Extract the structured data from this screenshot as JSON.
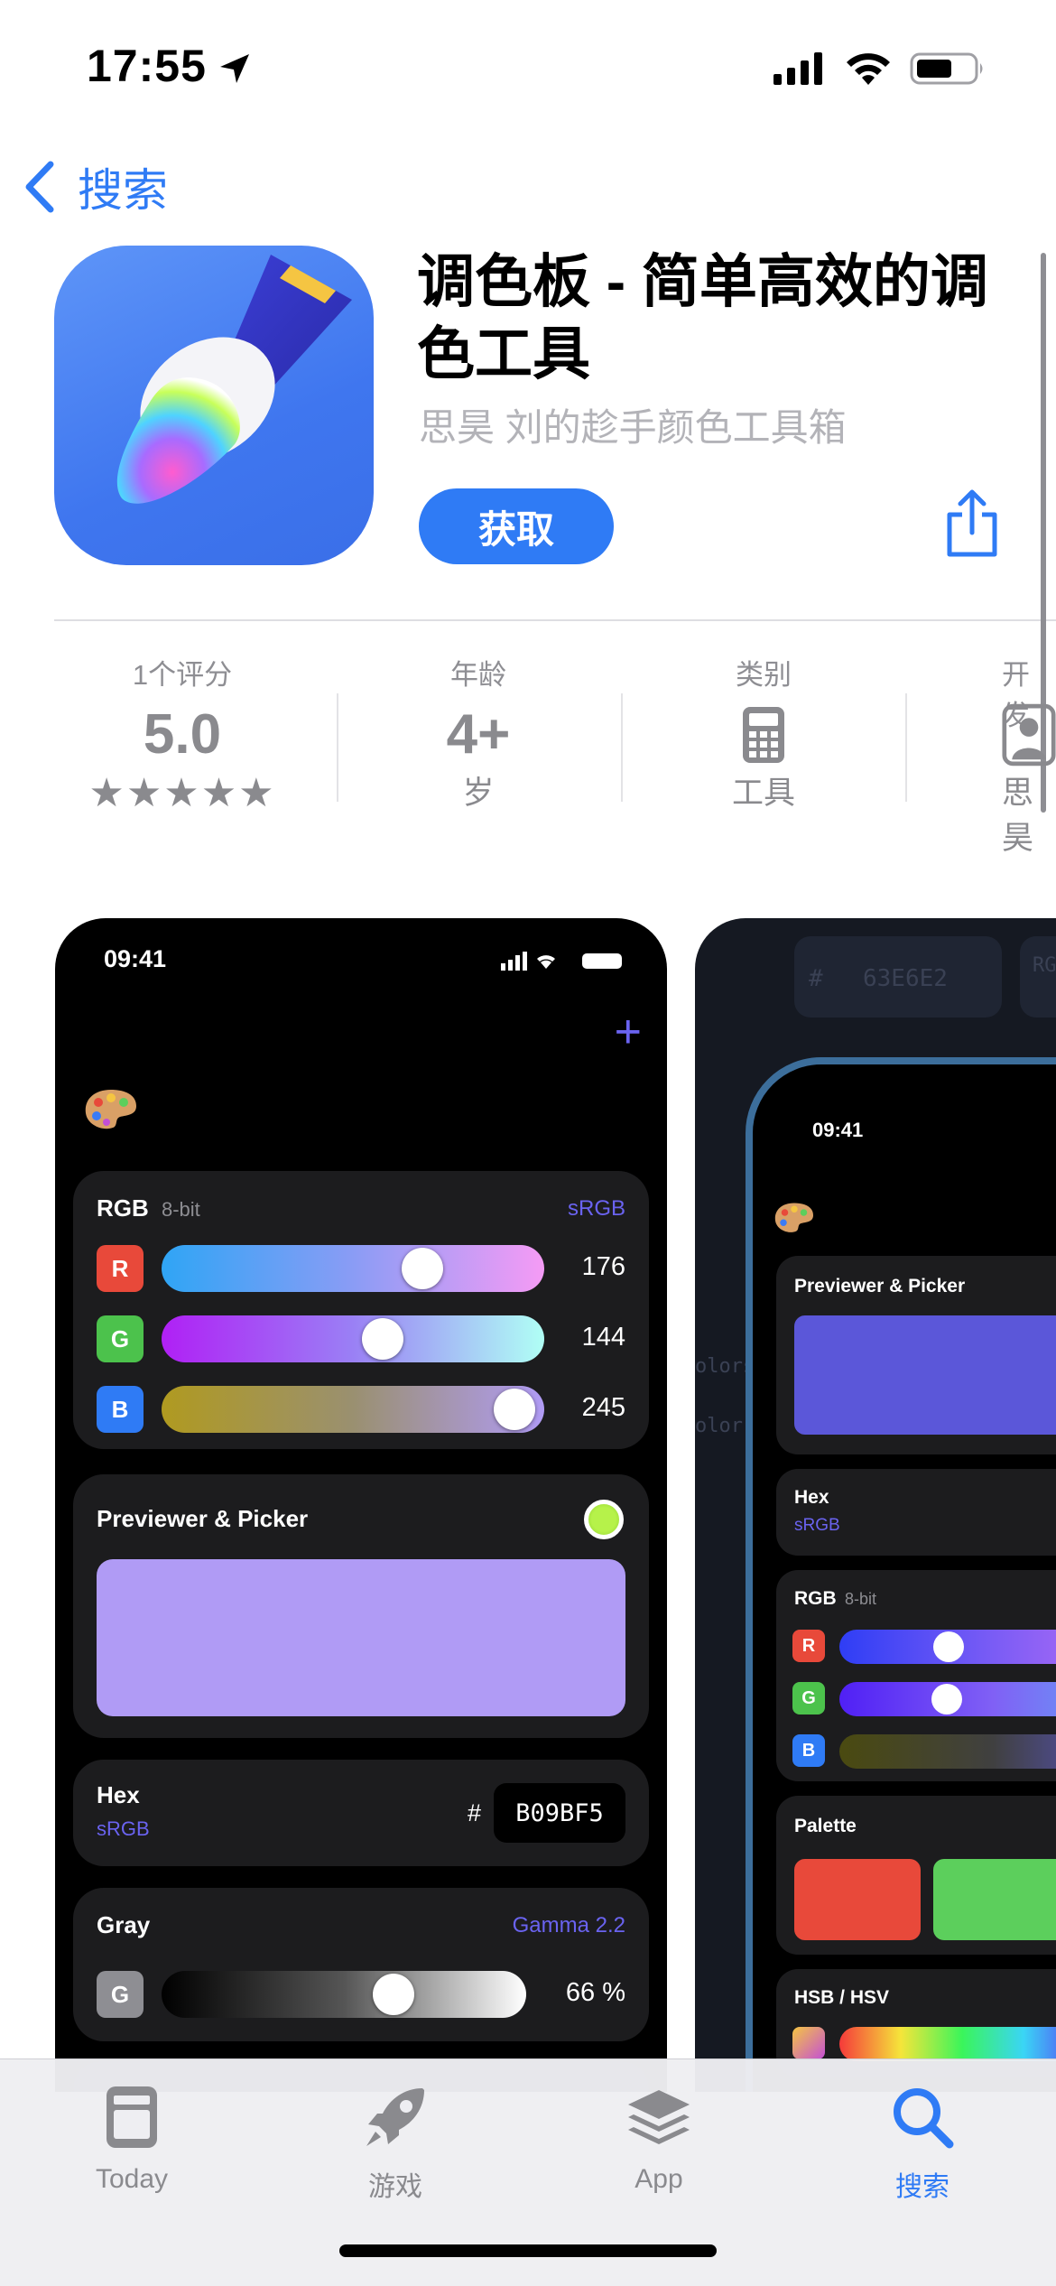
{
  "status_bar": {
    "time": "17:55"
  },
  "nav": {
    "back_label": "搜索"
  },
  "app": {
    "title": "调色板 - 简单高效的调色工具",
    "subtitle": "思昊 刘的趁手颜色工具箱",
    "get_label": "获取"
  },
  "info": [
    {
      "label": "1个评分",
      "value": "5.0",
      "sub": "★★★★★"
    },
    {
      "label": "年龄",
      "value": "4+",
      "sub": "岁"
    },
    {
      "label": "类别",
      "value": "",
      "sub": "工具",
      "icon": "calculator-icon"
    },
    {
      "label": "开发",
      "value": "",
      "sub": "思昊",
      "icon": "person-icon"
    }
  ],
  "screenshot1": {
    "time": "09:41",
    "rgb": {
      "title": "RGB",
      "bits": "8-bit",
      "space": "sRGB",
      "channels": [
        {
          "name": "R",
          "value": "176"
        },
        {
          "name": "G",
          "value": "144"
        },
        {
          "name": "B",
          "value": "245"
        }
      ]
    },
    "previewer": {
      "title": "Previewer & Picker",
      "color": "#b09bf5"
    },
    "hex": {
      "title": "Hex",
      "space": "sRGB",
      "hash": "#",
      "value": "B09BF5"
    },
    "gray": {
      "title": "Gray",
      "gamma": "Gamma 2.2",
      "channel": "G",
      "value": "66 %"
    }
  },
  "screenshot2": {
    "bg_hex": "63E6E2",
    "bg_label": "RG",
    "bg_frag1": "olors",
    "bg_frag2": "olor:",
    "time": "09:41",
    "previewer_title": "Previewer & Picker",
    "preview_color": "#5b57d9",
    "hex_title": "Hex",
    "hex_space": "sRGB",
    "rgb_title": "RGB",
    "rgb_bits": "8-bit",
    "channels": [
      "R",
      "G",
      "B"
    ],
    "palette_title": "Palette",
    "palette_colors": [
      "#e8493a",
      "#5ccf5c"
    ],
    "hsb_title": "HSB / HSV"
  },
  "tabs": [
    {
      "label": "Today",
      "icon": "today-icon",
      "active": false
    },
    {
      "label": "游戏",
      "icon": "rocket-icon",
      "active": false
    },
    {
      "label": "App",
      "icon": "layers-icon",
      "active": false
    },
    {
      "label": "搜索",
      "icon": "search-icon",
      "active": true
    }
  ],
  "colors": {
    "accent": "#2f7bf5",
    "app_accent": "#6a63f0"
  }
}
